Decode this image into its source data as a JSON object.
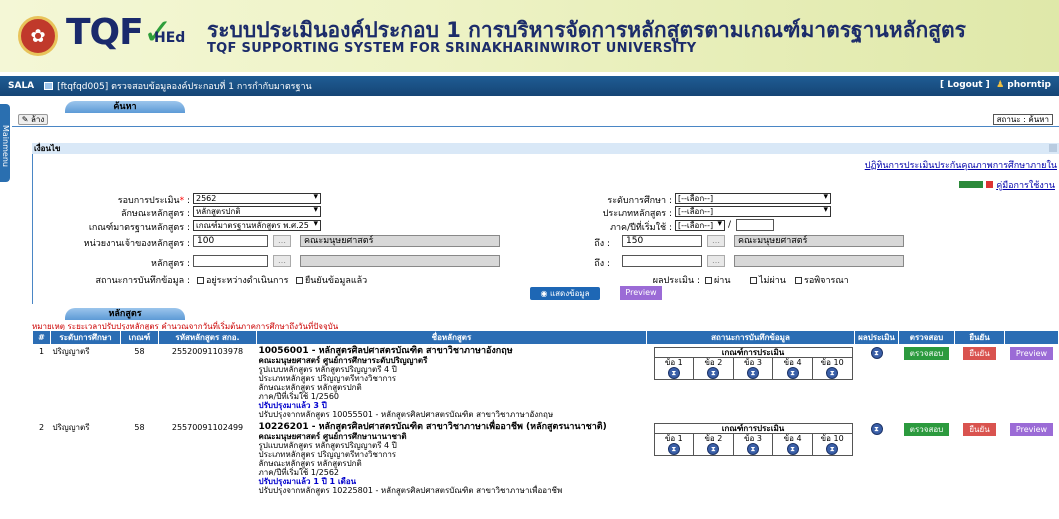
{
  "header": {
    "logo_text": "TQF",
    "logo_check": "✓",
    "logo_sub": "HEd",
    "title_th": "ระบบประเมินองค์ประกอบ 1 การบริหารจัดการหลักสูตรตามเกณฑ์มาตรฐานหลักสูตร",
    "title_en": "TQF SUPPORTING SYSTEM FOR SRINAKHARINWIROT UNIVERSITY"
  },
  "nav": {
    "sala": "SALA",
    "page": "[ftqfqd005] ตรวจสอบข้อมูลองค์ประกอบที่ 1 การกำกับมาตรฐาน",
    "logout": "[ Logout ]",
    "user": "phorntip"
  },
  "side_tab": "Mainmenu",
  "search_tab": "ค้นหา",
  "toolbar": {
    "edit_label": "ล้าง",
    "status_label": "สถานะ : ค้นหา"
  },
  "filter": {
    "header": "เงื่อนไข",
    "link_manual_top": "ปฏิทินการประเมินประกันคุณภาพการศึกษาภายใน",
    "manual_label": "คู่มือการใช้งาน",
    "round_label": "รอบการประเมิน",
    "round_value": "2562",
    "level_label": "ระดับการศึกษา :",
    "level_value": "[--เลือก--]",
    "char_label": "ลักษณะหลักสูตร :",
    "char_value": "หลักสูตรปกติ",
    "type_label": "ประเภทหลักสูตร :",
    "type_value": "[--เลือก--]",
    "std_label": "เกณฑ์มาตรฐานหลักสูตร :",
    "std_value": "เกณฑ์มาตรฐานหลักสูตร พ.ศ.25",
    "term_label": "ภาค/ปีที่เริ่มใช้ :",
    "term_value": "[--เลือก--]",
    "unit_label": "หน่วยงานเจ้าของหลักสูตร :",
    "unit_from": "100",
    "unit_from_name": "คณะมนุษยศาสตร์",
    "to_label": "ถึง :",
    "unit_to": "150",
    "unit_to_name": "คณะมนุษยศาสตร์",
    "course_label": "หลักสูตร :",
    "course_to_label": "ถึง :",
    "record_label": "สถานะการบันทึกข้อมูล :",
    "record_opt1": "อยู่ระหว่างดำเนินการ",
    "record_opt2": "ยืนยันข้อมูลแล้ว",
    "result_label": "ผลประเมิน :",
    "result_opt1": "ผ่าน",
    "result_opt2": "ไม่ผ่าน",
    "result_opt3": "รอพิจารณา",
    "show_button": "แสดงข้อมูล",
    "preview_button": "Preview"
  },
  "course_tab": "หลักสูตร",
  "note": {
    "label": "หมายเหตุ",
    "text": " ระยะเวลาปรับปรุงหลักสูตร คำนวณจากวันที่เริ่มต้นภาคการศึกษาถึงวันที่ปัจจุบัน"
  },
  "table": {
    "headers": [
      "#",
      "ระดับการศึกษา",
      "เกณฑ์",
      "รหัสหลักสูตร สกอ.",
      "ชื่อหลักสูตร",
      "สถานะการบันทึกข้อมูล",
      "ผลประเมิน",
      "ตรวจสอบ",
      "ยืนยัน",
      ""
    ],
    "criteria_header": "เกณฑ์การประเมิน",
    "criteria_cols": [
      "ข้อ 1",
      "ข้อ 2",
      "ข้อ 3",
      "ข้อ 4",
      "ข้อ 10"
    ],
    "check_label": "ตรวจสอบ",
    "confirm_label": "ยืนยัน",
    "preview_label": "Preview",
    "rows": [
      {
        "no": "1",
        "level": "ปริญญาตรี",
        "criteria": "58",
        "code": "25520091103978",
        "name": "10056001 - หลักสูตรศิลปศาสตรบัณฑิต สาขาวิชาภาษาอังกฤษ",
        "faculty": "คณะมนุษยศาสตร์ ศูนย์การศึกษาระดับปริญญาตรี",
        "format": "รูปแบบหลักสูตร หลักสูตรปริญญาตรี 4 ปี",
        "type": "ประเภทหลักสูตร ปริญญาตรีทางวิชาการ",
        "char": "ลักษณะหลักสูตร หลักสูตรปกติ",
        "term": "ภาค/ปีที่เริ่มใช้ 1/2560",
        "updated": "ปรับปรุงมาแล้ว 3 ปี",
        "update_from": "ปรับปรุงจากหลักสูตร 10055501 - หลักสูตรศิลปศาสตรบัณฑิต สาขาวิชาภาษาอังกฤษ"
      },
      {
        "no": "2",
        "level": "ปริญญาตรี",
        "criteria": "58",
        "code": "25570091102499",
        "name": "10226201 - หลักสูตรศิลปศาสตรบัณฑิต สาขาวิชาภาษาเพื่ออาชีพ (หลักสูตรนานาชาติ)",
        "faculty": "คณะมนุษยศาสตร์ ศูนย์การศึกษานานาชาติ",
        "format": "รูปแบบหลักสูตร หลักสูตรปริญญาตรี 4 ปี",
        "type": "ประเภทหลักสูตร ปริญญาตรีทางวิชาการ",
        "char": "ลักษณะหลักสูตร หลักสูตรปกติ",
        "term": "ภาค/ปีที่เริ่มใช้ 1/2562",
        "updated": "ปรับปรุงมาแล้ว 1 ปี 1 เดือน",
        "update_from": "ปรับปรุงจากหลักสูตร 10225801 - หลักสูตรศิลปศาสตรบัณฑิต สาขาวิชาภาษาเพื่ออาชีพ"
      }
    ]
  }
}
